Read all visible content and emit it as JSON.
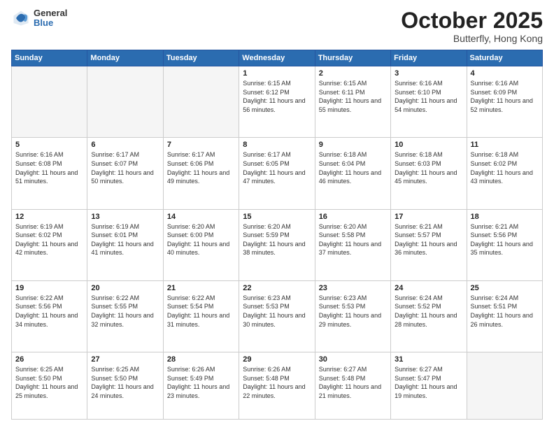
{
  "header": {
    "logo": {
      "general": "General",
      "blue": "Blue"
    },
    "title": "October 2025",
    "location": "Butterfly, Hong Kong"
  },
  "weekdays": [
    "Sunday",
    "Monday",
    "Tuesday",
    "Wednesday",
    "Thursday",
    "Friday",
    "Saturday"
  ],
  "weeks": [
    [
      {
        "day": "",
        "empty": true
      },
      {
        "day": "",
        "empty": true
      },
      {
        "day": "",
        "empty": true
      },
      {
        "day": "1",
        "sunrise": "6:15 AM",
        "sunset": "6:12 PM",
        "daylight": "11 hours and 56 minutes."
      },
      {
        "day": "2",
        "sunrise": "6:15 AM",
        "sunset": "6:11 PM",
        "daylight": "11 hours and 55 minutes."
      },
      {
        "day": "3",
        "sunrise": "6:16 AM",
        "sunset": "6:10 PM",
        "daylight": "11 hours and 54 minutes."
      },
      {
        "day": "4",
        "sunrise": "6:16 AM",
        "sunset": "6:09 PM",
        "daylight": "11 hours and 52 minutes."
      }
    ],
    [
      {
        "day": "5",
        "sunrise": "6:16 AM",
        "sunset": "6:08 PM",
        "daylight": "11 hours and 51 minutes."
      },
      {
        "day": "6",
        "sunrise": "6:17 AM",
        "sunset": "6:07 PM",
        "daylight": "11 hours and 50 minutes."
      },
      {
        "day": "7",
        "sunrise": "6:17 AM",
        "sunset": "6:06 PM",
        "daylight": "11 hours and 49 minutes."
      },
      {
        "day": "8",
        "sunrise": "6:17 AM",
        "sunset": "6:05 PM",
        "daylight": "11 hours and 47 minutes."
      },
      {
        "day": "9",
        "sunrise": "6:18 AM",
        "sunset": "6:04 PM",
        "daylight": "11 hours and 46 minutes."
      },
      {
        "day": "10",
        "sunrise": "6:18 AM",
        "sunset": "6:03 PM",
        "daylight": "11 hours and 45 minutes."
      },
      {
        "day": "11",
        "sunrise": "6:18 AM",
        "sunset": "6:02 PM",
        "daylight": "11 hours and 43 minutes."
      }
    ],
    [
      {
        "day": "12",
        "sunrise": "6:19 AM",
        "sunset": "6:02 PM",
        "daylight": "11 hours and 42 minutes."
      },
      {
        "day": "13",
        "sunrise": "6:19 AM",
        "sunset": "6:01 PM",
        "daylight": "11 hours and 41 minutes."
      },
      {
        "day": "14",
        "sunrise": "6:20 AM",
        "sunset": "6:00 PM",
        "daylight": "11 hours and 40 minutes."
      },
      {
        "day": "15",
        "sunrise": "6:20 AM",
        "sunset": "5:59 PM",
        "daylight": "11 hours and 38 minutes."
      },
      {
        "day": "16",
        "sunrise": "6:20 AM",
        "sunset": "5:58 PM",
        "daylight": "11 hours and 37 minutes."
      },
      {
        "day": "17",
        "sunrise": "6:21 AM",
        "sunset": "5:57 PM",
        "daylight": "11 hours and 36 minutes."
      },
      {
        "day": "18",
        "sunrise": "6:21 AM",
        "sunset": "5:56 PM",
        "daylight": "11 hours and 35 minutes."
      }
    ],
    [
      {
        "day": "19",
        "sunrise": "6:22 AM",
        "sunset": "5:56 PM",
        "daylight": "11 hours and 34 minutes."
      },
      {
        "day": "20",
        "sunrise": "6:22 AM",
        "sunset": "5:55 PM",
        "daylight": "11 hours and 32 minutes."
      },
      {
        "day": "21",
        "sunrise": "6:22 AM",
        "sunset": "5:54 PM",
        "daylight": "11 hours and 31 minutes."
      },
      {
        "day": "22",
        "sunrise": "6:23 AM",
        "sunset": "5:53 PM",
        "daylight": "11 hours and 30 minutes."
      },
      {
        "day": "23",
        "sunrise": "6:23 AM",
        "sunset": "5:53 PM",
        "daylight": "11 hours and 29 minutes."
      },
      {
        "day": "24",
        "sunrise": "6:24 AM",
        "sunset": "5:52 PM",
        "daylight": "11 hours and 28 minutes."
      },
      {
        "day": "25",
        "sunrise": "6:24 AM",
        "sunset": "5:51 PM",
        "daylight": "11 hours and 26 minutes."
      }
    ],
    [
      {
        "day": "26",
        "sunrise": "6:25 AM",
        "sunset": "5:50 PM",
        "daylight": "11 hours and 25 minutes."
      },
      {
        "day": "27",
        "sunrise": "6:25 AM",
        "sunset": "5:50 PM",
        "daylight": "11 hours and 24 minutes."
      },
      {
        "day": "28",
        "sunrise": "6:26 AM",
        "sunset": "5:49 PM",
        "daylight": "11 hours and 23 minutes."
      },
      {
        "day": "29",
        "sunrise": "6:26 AM",
        "sunset": "5:48 PM",
        "daylight": "11 hours and 22 minutes."
      },
      {
        "day": "30",
        "sunrise": "6:27 AM",
        "sunset": "5:48 PM",
        "daylight": "11 hours and 21 minutes."
      },
      {
        "day": "31",
        "sunrise": "6:27 AM",
        "sunset": "5:47 PM",
        "daylight": "11 hours and 19 minutes."
      },
      {
        "day": "",
        "empty": true
      }
    ]
  ]
}
